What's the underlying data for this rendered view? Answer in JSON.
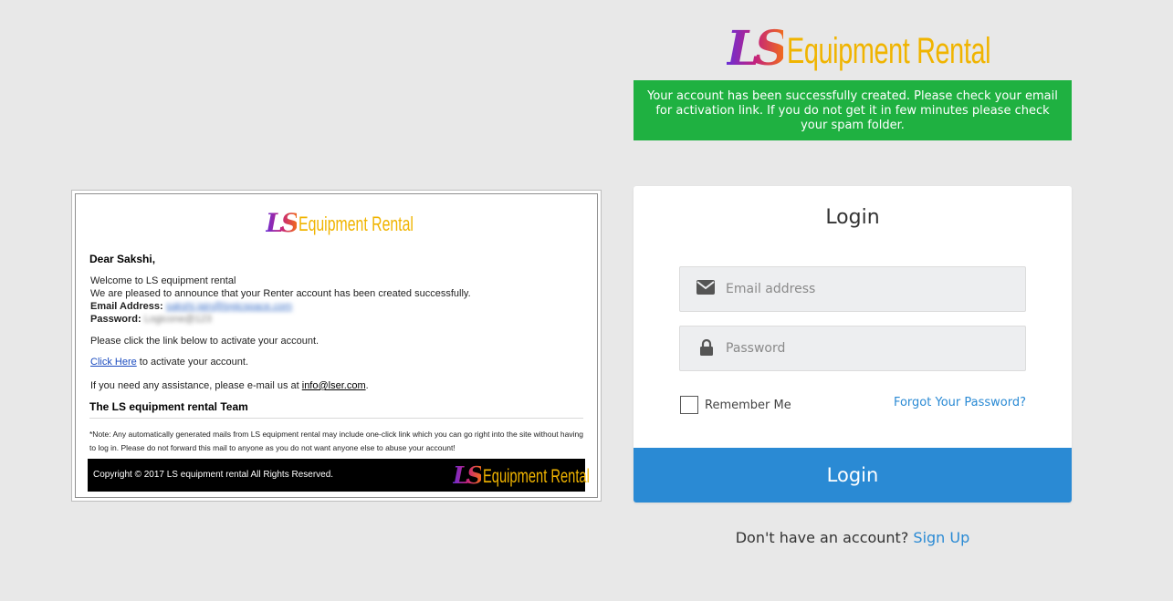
{
  "brand": {
    "mark": "LS",
    "name": "Equipment Rental"
  },
  "alert": {
    "message": "Your account has been successfully created. Please check your email for activation link. If you do not get it in few minutes please check your spam folder."
  },
  "email_preview": {
    "greeting": "Dear Sakshi,",
    "welcome": "Welcome to LS equipment rental",
    "announce": "We are pleased to announce that your Renter account has been created successfully.",
    "email_label": "Email Address:",
    "email_value": "sakshi.jain@logicspace.com",
    "password_label": "Password:",
    "password_value": "Logicone@123",
    "click_instruction": "Please click the link below to activate your account.",
    "click_here": "Click Here",
    "activate_suffix": " to activate your account.",
    "assist_prefix": "If you need any assistance, please e-mail us at ",
    "assist_email": "info@lser.com",
    "assist_suffix": ".",
    "team_signature": "The LS equipment rental Team",
    "note": "*Note: Any automatically generated mails from LS equipment rental may include one-click link which you can go right into the site without having to log in. Please do not forward this mail to anyone as you do not want anyone else to abuse your account!",
    "copyright": "Copyright © 2017 LS equipment rental All Rights Reserved."
  },
  "login": {
    "title": "Login",
    "email_placeholder": "Email address",
    "password_placeholder": "Password",
    "remember_label": "Remember Me",
    "remember_checked": false,
    "forgot_label": "Forgot Your Password?",
    "submit_label": "Login"
  },
  "signup": {
    "prompt": "Don't have an account?",
    "link_label": "Sign Up"
  },
  "icons": {
    "email": "envelope-icon",
    "password": "lock-icon"
  },
  "colors": {
    "background": "#e8e8e8",
    "success": "#1fb141",
    "primary": "#2a8ad4",
    "brand_gold": "#f0b400"
  }
}
